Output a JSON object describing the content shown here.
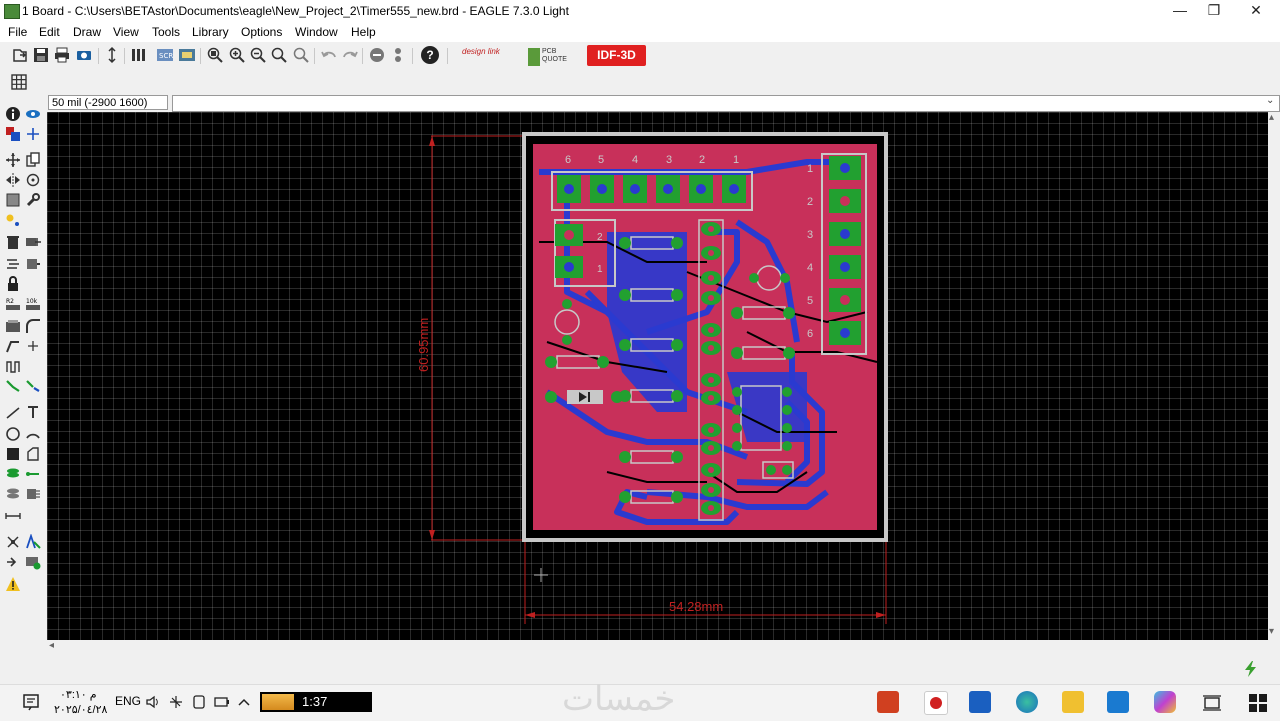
{
  "window": {
    "title": "1 Board - C:\\Users\\BETAstor\\Documents\\eagle\\New_Project_2\\Timer555_new.brd - EAGLE 7.3.0 Light",
    "minimize_glyph": "—",
    "restore_glyph": "❐",
    "close_glyph": "✕"
  },
  "menu": {
    "items": [
      "File",
      "Edit",
      "Draw",
      "View",
      "Tools",
      "Library",
      "Options",
      "Window",
      "Help"
    ]
  },
  "toolbar": {
    "help_glyph": "?",
    "designlink_label": "design link",
    "pcbquote_label": "PCB QUOTE",
    "idf3d_label": "IDF-3D"
  },
  "params": {
    "grid_coords": "50 mil (-2900 1600)",
    "command": ""
  },
  "board": {
    "height_dim": "60.95mm",
    "width_dim": "54.28mm",
    "header_pin_labels": [
      "6",
      "5",
      "4",
      "3",
      "2",
      "1"
    ],
    "side_pin_labels": [
      "1",
      "2",
      "3",
      "4",
      "5",
      "6"
    ],
    "small_header_labels": [
      "2",
      "1"
    ],
    "colors": {
      "top_copper": "#c8305a",
      "bottom_copper": "#2a3ad0",
      "pad": "#22a030",
      "silk": "#c8c8c8",
      "dimension": "#c02020"
    }
  },
  "taskbar": {
    "clock_time": "م ۰۳:۱۰",
    "clock_date": "۲۰۲۵/۰٤/۲۸",
    "language": "ENG",
    "media_time": "1:37",
    "watermark": "خمسات"
  }
}
